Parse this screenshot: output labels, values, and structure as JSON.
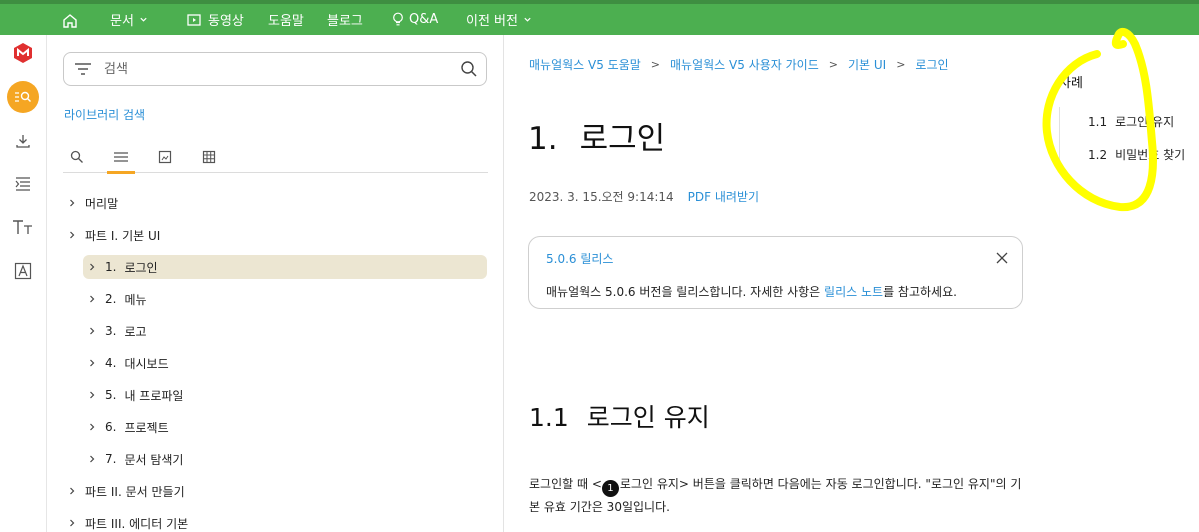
{
  "topnav": {
    "home_icon": "home-icon",
    "items": [
      "문서",
      "동영상",
      "도움말",
      "블로그",
      "Q&A",
      "이전 버전"
    ]
  },
  "rail": {
    "icons": [
      "manual-logo-icon",
      "search-doc-icon",
      "download-icon",
      "indent-icon",
      "font-size-icon",
      "reader-mode-icon"
    ],
    "accent": "#f5a623"
  },
  "sidebar": {
    "search_placeholder": "검색",
    "library_search": "라이브러리 검색",
    "tabs": [
      "search-tab-icon",
      "toc-tab-icon",
      "image-tab-icon",
      "table-tab-icon"
    ],
    "tree": [
      {
        "label": "머리말"
      },
      {
        "label": "파트 I.  기본 UI"
      },
      {
        "num": "1.",
        "label": "로그인",
        "selected": true
      },
      {
        "num": "2.",
        "label": "메뉴"
      },
      {
        "num": "3.",
        "label": "로고"
      },
      {
        "num": "4.",
        "label": "대시보드"
      },
      {
        "num": "5.",
        "label": "내 프로파일"
      },
      {
        "num": "6.",
        "label": "프로젝트"
      },
      {
        "num": "7.",
        "label": "문서 탐색기"
      },
      {
        "label": "파트 II.  문서 만들기"
      },
      {
        "label": "파트 III.  에디터 기본"
      }
    ]
  },
  "main": {
    "breadcrumbs": [
      "매뉴얼웍스 V5 도움말",
      "매뉴얼웍스 V5 사용자 가이드",
      "기본 UI",
      "로그인"
    ],
    "title_num": "1.",
    "title": "로그인",
    "date": "2023. 3. 15.오전 9:14:14",
    "pdf": "PDF 내려받기",
    "notice": {
      "title": "5.0.6 릴리스",
      "body_before": "매뉴얼웍스 5.0.6 버전을 릴리스합니다. 자세한 사항은 ",
      "link": "릴리스 노트",
      "body_after": "를 참고하세요."
    },
    "section_num": "1.1",
    "section_title": "로그인 유지",
    "para_before": "로그인할 때 <",
    "badge": "1",
    "para_after": "로그인 유지> 버튼을 클릭하면 다음에는 자동 로그인합니다. \"로그인 유지\"의 기본 유효 기간은 30일입니다."
  },
  "toc": {
    "title": "차례",
    "items": [
      {
        "num": "1.1",
        "label": "로그인 유지"
      },
      {
        "num": "1.2",
        "label": "비밀번호 찾기"
      }
    ]
  },
  "colors": {
    "topbar": "#4caf50",
    "link": "#2a8fd6",
    "highlight": "#ffff00",
    "selected_row": "#ece6d2"
  }
}
